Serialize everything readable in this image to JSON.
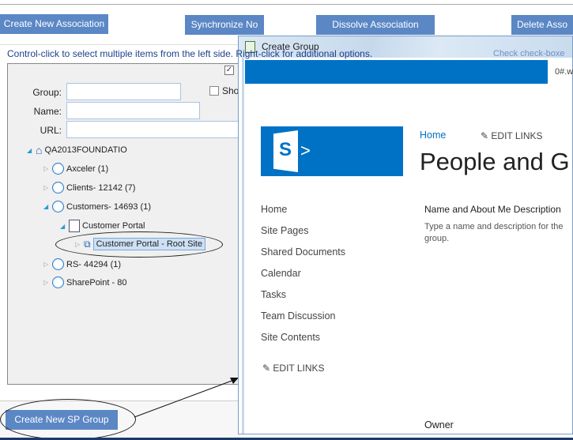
{
  "toolbar": {
    "create_assoc": "Create New Association",
    "sync": "Synchronize No",
    "dissolve": "Dissolve Association",
    "delete": "Delete Asso"
  },
  "instructions": {
    "left": "Control-click to select multiple items from the left side. Right-click for additional options.",
    "right": "Check check-boxe"
  },
  "form": {
    "group_label": "Group:",
    "name_label": "Name:",
    "url_label": "URL:",
    "group_value": "",
    "name_value": "",
    "url_value": "",
    "show_label": "Sho"
  },
  "tree": {
    "root": "QA2013FOUNDATIO",
    "items": [
      "Axceler (1)",
      "Clients- 12142 (7)",
      "Customers- 14693 (1)",
      "Customer Portal",
      "Customer Portal - Root Site",
      "RS- 44294 (1)",
      "SharePoint - 80"
    ]
  },
  "footer": {
    "create_sp_group": "Create New SP Group"
  },
  "dialog": {
    "title": "Create Group",
    "user": "0#.w",
    "breadcrumb_home": "Home",
    "edit_links": "EDIT LINKS",
    "page_title": "People and G",
    "nav": [
      "Home",
      "Site Pages",
      "Shared Documents",
      "Calendar",
      "Tasks",
      "Team Discussion",
      "Site Contents"
    ],
    "nav_edit_links": "EDIT LINKS",
    "section_title": "Name and About Me Description",
    "section_desc": "Type a name and description for the group.",
    "owner_label": "Owner",
    "brand_color": "#0072c6"
  }
}
